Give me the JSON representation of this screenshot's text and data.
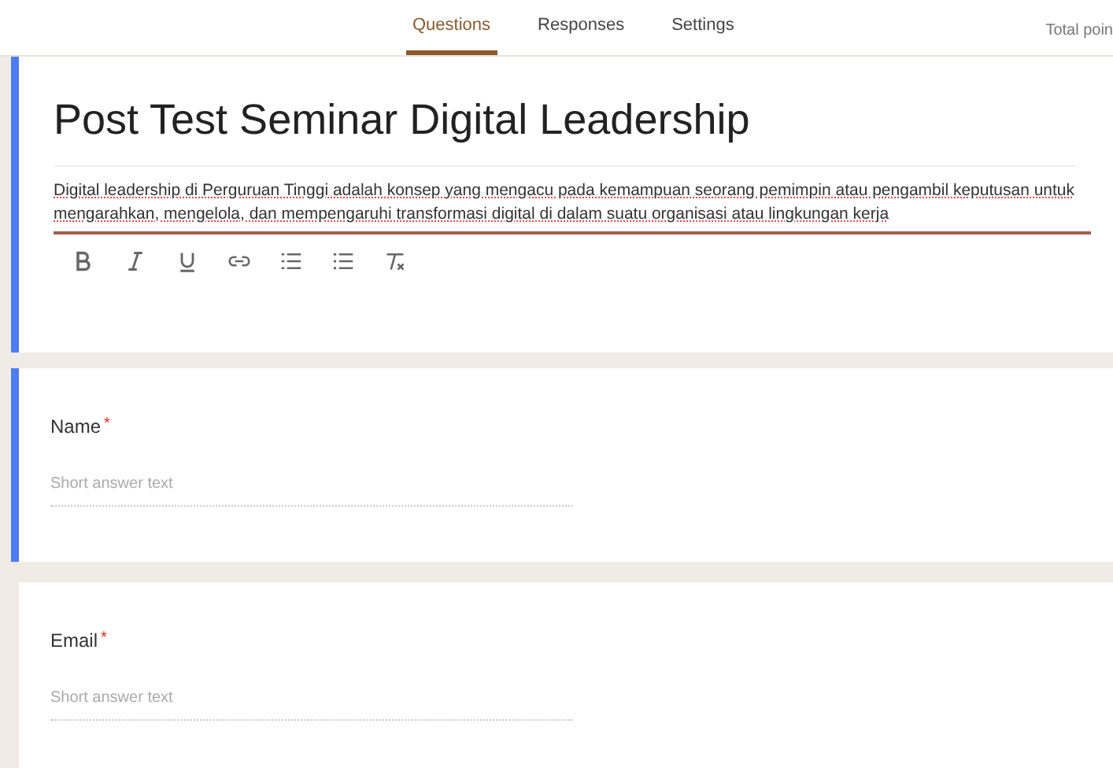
{
  "tabs": [
    {
      "label": "Questions",
      "selected": true
    },
    {
      "label": "Responses",
      "selected": false
    },
    {
      "label": "Settings",
      "selected": false
    }
  ],
  "total_points": "Total poin",
  "header": {
    "title": "Post Test Seminar Digital Leadership",
    "description": "Digital leadership di Perguruan Tinggi  adalah konsep yang mengacu pada kemampuan seorang pemimpin atau pengambil keputusan untuk mengarahkan, mengelola, dan mempengaruhi transformasi digital di dalam suatu organisasi atau lingkungan kerja",
    "focused": true
  },
  "format_toolbar": [
    {
      "kind": "bold"
    },
    {
      "kind": "italic"
    },
    {
      "kind": "underline"
    },
    {
      "kind": "link"
    },
    {
      "kind": "numbered"
    },
    {
      "kind": "bulleted"
    },
    {
      "kind": "clear"
    }
  ],
  "questions": [
    {
      "title": "Name",
      "required_mark": "*",
      "placeholder": "Short answer text",
      "focused": true
    },
    {
      "title": "Email",
      "required_mark": "*",
      "placeholder": "Short answer text",
      "focused": false
    }
  ]
}
